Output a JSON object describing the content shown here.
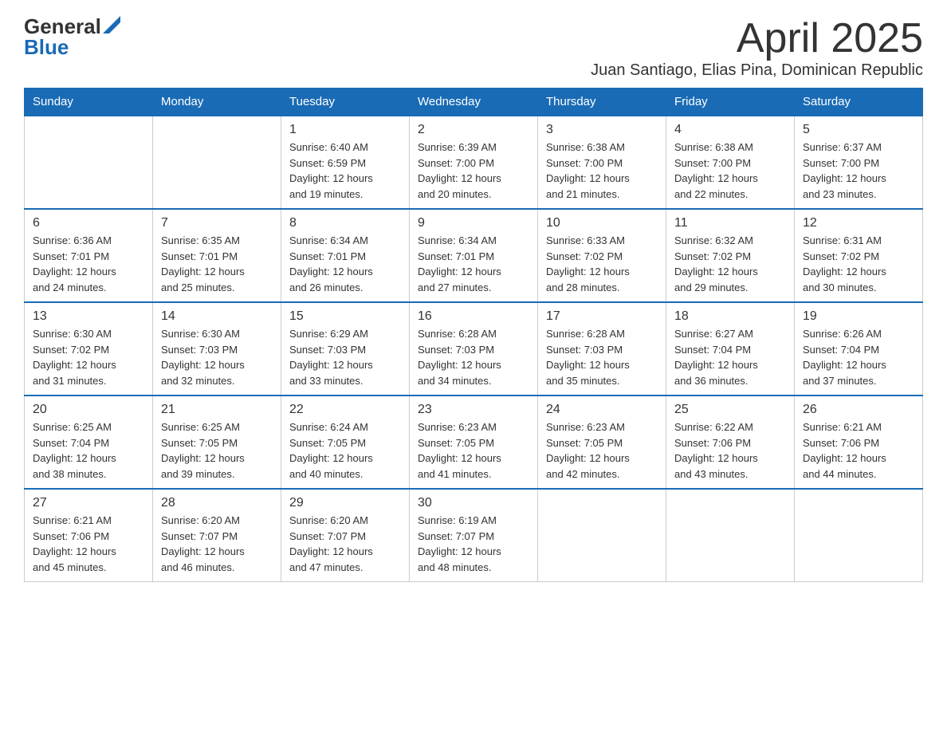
{
  "header": {
    "logo": {
      "text_general": "General",
      "text_blue": "Blue"
    },
    "title": "April 2025",
    "location": "Juan Santiago, Elias Pina, Dominican Republic"
  },
  "calendar": {
    "days_of_week": [
      "Sunday",
      "Monday",
      "Tuesday",
      "Wednesday",
      "Thursday",
      "Friday",
      "Saturday"
    ],
    "weeks": [
      [
        {
          "day": "",
          "info": ""
        },
        {
          "day": "",
          "info": ""
        },
        {
          "day": "1",
          "info": "Sunrise: 6:40 AM\nSunset: 6:59 PM\nDaylight: 12 hours\nand 19 minutes."
        },
        {
          "day": "2",
          "info": "Sunrise: 6:39 AM\nSunset: 7:00 PM\nDaylight: 12 hours\nand 20 minutes."
        },
        {
          "day": "3",
          "info": "Sunrise: 6:38 AM\nSunset: 7:00 PM\nDaylight: 12 hours\nand 21 minutes."
        },
        {
          "day": "4",
          "info": "Sunrise: 6:38 AM\nSunset: 7:00 PM\nDaylight: 12 hours\nand 22 minutes."
        },
        {
          "day": "5",
          "info": "Sunrise: 6:37 AM\nSunset: 7:00 PM\nDaylight: 12 hours\nand 23 minutes."
        }
      ],
      [
        {
          "day": "6",
          "info": "Sunrise: 6:36 AM\nSunset: 7:01 PM\nDaylight: 12 hours\nand 24 minutes."
        },
        {
          "day": "7",
          "info": "Sunrise: 6:35 AM\nSunset: 7:01 PM\nDaylight: 12 hours\nand 25 minutes."
        },
        {
          "day": "8",
          "info": "Sunrise: 6:34 AM\nSunset: 7:01 PM\nDaylight: 12 hours\nand 26 minutes."
        },
        {
          "day": "9",
          "info": "Sunrise: 6:34 AM\nSunset: 7:01 PM\nDaylight: 12 hours\nand 27 minutes."
        },
        {
          "day": "10",
          "info": "Sunrise: 6:33 AM\nSunset: 7:02 PM\nDaylight: 12 hours\nand 28 minutes."
        },
        {
          "day": "11",
          "info": "Sunrise: 6:32 AM\nSunset: 7:02 PM\nDaylight: 12 hours\nand 29 minutes."
        },
        {
          "day": "12",
          "info": "Sunrise: 6:31 AM\nSunset: 7:02 PM\nDaylight: 12 hours\nand 30 minutes."
        }
      ],
      [
        {
          "day": "13",
          "info": "Sunrise: 6:30 AM\nSunset: 7:02 PM\nDaylight: 12 hours\nand 31 minutes."
        },
        {
          "day": "14",
          "info": "Sunrise: 6:30 AM\nSunset: 7:03 PM\nDaylight: 12 hours\nand 32 minutes."
        },
        {
          "day": "15",
          "info": "Sunrise: 6:29 AM\nSunset: 7:03 PM\nDaylight: 12 hours\nand 33 minutes."
        },
        {
          "day": "16",
          "info": "Sunrise: 6:28 AM\nSunset: 7:03 PM\nDaylight: 12 hours\nand 34 minutes."
        },
        {
          "day": "17",
          "info": "Sunrise: 6:28 AM\nSunset: 7:03 PM\nDaylight: 12 hours\nand 35 minutes."
        },
        {
          "day": "18",
          "info": "Sunrise: 6:27 AM\nSunset: 7:04 PM\nDaylight: 12 hours\nand 36 minutes."
        },
        {
          "day": "19",
          "info": "Sunrise: 6:26 AM\nSunset: 7:04 PM\nDaylight: 12 hours\nand 37 minutes."
        }
      ],
      [
        {
          "day": "20",
          "info": "Sunrise: 6:25 AM\nSunset: 7:04 PM\nDaylight: 12 hours\nand 38 minutes."
        },
        {
          "day": "21",
          "info": "Sunrise: 6:25 AM\nSunset: 7:05 PM\nDaylight: 12 hours\nand 39 minutes."
        },
        {
          "day": "22",
          "info": "Sunrise: 6:24 AM\nSunset: 7:05 PM\nDaylight: 12 hours\nand 40 minutes."
        },
        {
          "day": "23",
          "info": "Sunrise: 6:23 AM\nSunset: 7:05 PM\nDaylight: 12 hours\nand 41 minutes."
        },
        {
          "day": "24",
          "info": "Sunrise: 6:23 AM\nSunset: 7:05 PM\nDaylight: 12 hours\nand 42 minutes."
        },
        {
          "day": "25",
          "info": "Sunrise: 6:22 AM\nSunset: 7:06 PM\nDaylight: 12 hours\nand 43 minutes."
        },
        {
          "day": "26",
          "info": "Sunrise: 6:21 AM\nSunset: 7:06 PM\nDaylight: 12 hours\nand 44 minutes."
        }
      ],
      [
        {
          "day": "27",
          "info": "Sunrise: 6:21 AM\nSunset: 7:06 PM\nDaylight: 12 hours\nand 45 minutes."
        },
        {
          "day": "28",
          "info": "Sunrise: 6:20 AM\nSunset: 7:07 PM\nDaylight: 12 hours\nand 46 minutes."
        },
        {
          "day": "29",
          "info": "Sunrise: 6:20 AM\nSunset: 7:07 PM\nDaylight: 12 hours\nand 47 minutes."
        },
        {
          "day": "30",
          "info": "Sunrise: 6:19 AM\nSunset: 7:07 PM\nDaylight: 12 hours\nand 48 minutes."
        },
        {
          "day": "",
          "info": ""
        },
        {
          "day": "",
          "info": ""
        },
        {
          "day": "",
          "info": ""
        }
      ]
    ]
  }
}
